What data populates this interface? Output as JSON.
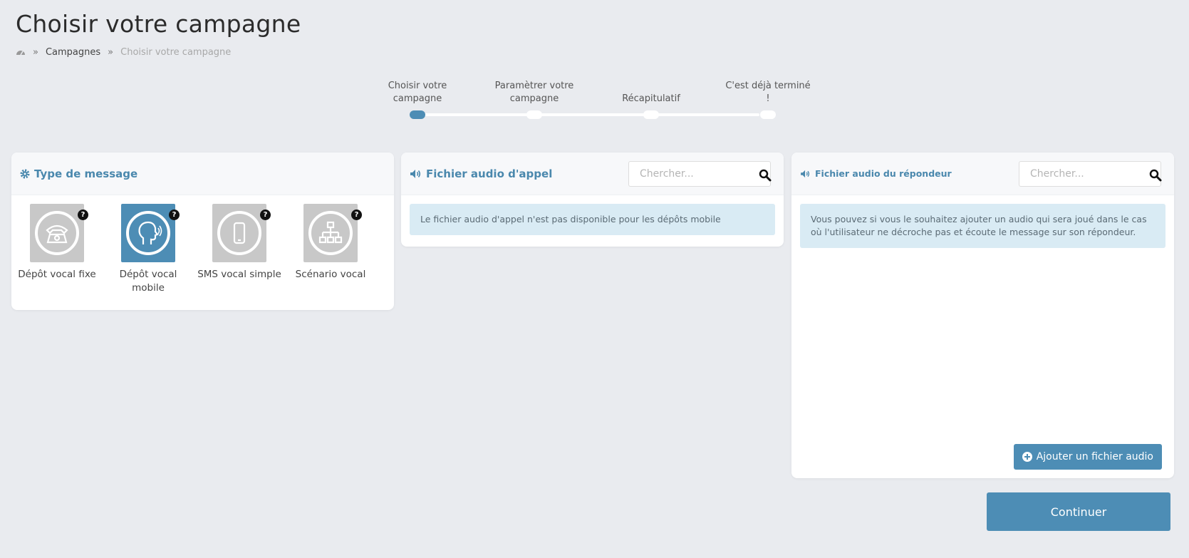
{
  "page": {
    "title": "Choisir votre campagne"
  },
  "breadcrumb": {
    "home_icon": "dashboard-icon",
    "separator": "»",
    "items": [
      "Campagnes",
      "Choisir votre campagne"
    ]
  },
  "stepper": {
    "steps": [
      {
        "label": "Choisir votre campagne",
        "active": true
      },
      {
        "label": "Paramètrer votre campagne",
        "active": false
      },
      {
        "label": "Récapitulatif",
        "active": false
      },
      {
        "label": "C'est déjà terminé !",
        "active": false
      }
    ]
  },
  "message_type_panel": {
    "title": "Type de message",
    "icon": "gear-icon",
    "types": [
      {
        "label": "Dépôt vocal fixe",
        "icon": "telephone-icon",
        "selected": false
      },
      {
        "label": "Dépôt vocal mobile",
        "icon": "speaking-head-icon",
        "selected": true
      },
      {
        "label": "SMS vocal simple",
        "icon": "mobile-phone-icon",
        "selected": false
      },
      {
        "label": "Scénario vocal",
        "icon": "sitemap-icon",
        "selected": false
      }
    ],
    "help_symbol": "?"
  },
  "call_audio_panel": {
    "title": "Fichier audio d'appel",
    "icon": "volume-icon",
    "search_placeholder": "Chercher...",
    "info": "Le fichier audio d'appel n'est pas disponible pour les dépôts mobile"
  },
  "voicemail_audio_panel": {
    "title": "Fichier audio du répondeur",
    "icon": "volume-icon",
    "search_placeholder": "Chercher...",
    "info": "Vous pouvez si vous le souhaitez ajouter un audio qui sera joué dans le cas où l'utilisateur ne décroche pas et écoute le message sur son répondeur.",
    "add_button": "Ajouter un fichier audio"
  },
  "continue_button": "Continuer",
  "colors": {
    "accent": "#4d8db5",
    "title_blue": "#4a88ad",
    "info_bg": "#d9ebf4",
    "background": "#e9ebef"
  }
}
